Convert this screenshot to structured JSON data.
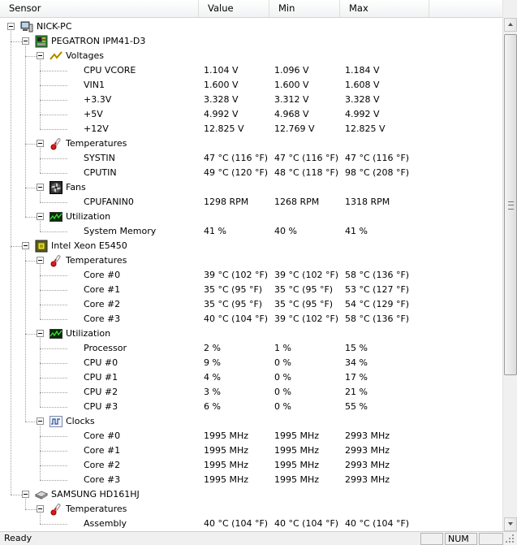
{
  "columns": {
    "sensor": "Sensor",
    "value": "Value",
    "min": "Min",
    "max": "Max"
  },
  "rows": [
    {
      "level": 0,
      "kind": "node",
      "icon": "computer-icon",
      "label": "NICK-PC"
    },
    {
      "level": 1,
      "kind": "node",
      "icon": "motherboard-icon",
      "label": "PEGATRON IPM41-D3"
    },
    {
      "level": 2,
      "kind": "node",
      "icon": "voltage-icon",
      "label": "Voltages"
    },
    {
      "level": 3,
      "kind": "leaf",
      "label": "CPU VCORE",
      "value": "1.104 V",
      "min": "1.096 V",
      "max": "1.184 V"
    },
    {
      "level": 3,
      "kind": "leaf",
      "label": "VIN1",
      "value": "1.600 V",
      "min": "1.600 V",
      "max": "1.608 V"
    },
    {
      "level": 3,
      "kind": "leaf",
      "label": "+3.3V",
      "value": "3.328 V",
      "min": "3.312 V",
      "max": "3.328 V"
    },
    {
      "level": 3,
      "kind": "leaf",
      "label": "+5V",
      "value": "4.992 V",
      "min": "4.968 V",
      "max": "4.992 V"
    },
    {
      "level": 3,
      "kind": "leaf",
      "label": "+12V",
      "value": "12.825 V",
      "min": "12.769 V",
      "max": "12.825 V"
    },
    {
      "level": 2,
      "kind": "node",
      "icon": "thermometer-icon",
      "label": "Temperatures"
    },
    {
      "level": 3,
      "kind": "leaf",
      "label": "SYSTIN",
      "value": "47 °C  (116 °F)",
      "min": "47 °C  (116 °F)",
      "max": "47 °C  (116 °F)"
    },
    {
      "level": 3,
      "kind": "leaf",
      "label": "CPUTIN",
      "value": "49 °C  (120 °F)",
      "min": "48 °C  (118 °F)",
      "max": "98 °C  (208 °F)"
    },
    {
      "level": 2,
      "kind": "node",
      "icon": "fan-icon",
      "label": "Fans"
    },
    {
      "level": 3,
      "kind": "leaf",
      "label": "CPUFANIN0",
      "value": "1298 RPM",
      "min": "1268 RPM",
      "max": "1318 RPM"
    },
    {
      "level": 2,
      "kind": "node",
      "icon": "utilization-icon",
      "label": "Utilization"
    },
    {
      "level": 3,
      "kind": "leaf",
      "label": "System Memory",
      "value": "41 %",
      "min": "40 %",
      "max": "41 %"
    },
    {
      "level": 1,
      "kind": "node",
      "icon": "cpu-chip-icon",
      "label": "Intel Xeon E5450"
    },
    {
      "level": 2,
      "kind": "node",
      "icon": "thermometer-icon",
      "label": "Temperatures"
    },
    {
      "level": 3,
      "kind": "leaf",
      "label": "Core #0",
      "value": "39 °C  (102 °F)",
      "min": "39 °C  (102 °F)",
      "max": "58 °C  (136 °F)"
    },
    {
      "level": 3,
      "kind": "leaf",
      "label": "Core #1",
      "value": "35 °C  (95 °F)",
      "min": "35 °C  (95 °F)",
      "max": "53 °C  (127 °F)"
    },
    {
      "level": 3,
      "kind": "leaf",
      "label": "Core #2",
      "value": "35 °C  (95 °F)",
      "min": "35 °C  (95 °F)",
      "max": "54 °C  (129 °F)"
    },
    {
      "level": 3,
      "kind": "leaf",
      "label": "Core #3",
      "value": "40 °C  (104 °F)",
      "min": "39 °C  (102 °F)",
      "max": "58 °C  (136 °F)"
    },
    {
      "level": 2,
      "kind": "node",
      "icon": "utilization-icon",
      "label": "Utilization"
    },
    {
      "level": 3,
      "kind": "leaf",
      "label": "Processor",
      "value": "2 %",
      "min": "1 %",
      "max": "15 %"
    },
    {
      "level": 3,
      "kind": "leaf",
      "label": "CPU #0",
      "value": "9 %",
      "min": "0 %",
      "max": "34 %"
    },
    {
      "level": 3,
      "kind": "leaf",
      "label": "CPU #1",
      "value": "4 %",
      "min": "0 %",
      "max": "17 %"
    },
    {
      "level": 3,
      "kind": "leaf",
      "label": "CPU #2",
      "value": "3 %",
      "min": "0 %",
      "max": "21 %"
    },
    {
      "level": 3,
      "kind": "leaf",
      "label": "CPU #3",
      "value": "6 %",
      "min": "0 %",
      "max": "55 %"
    },
    {
      "level": 2,
      "kind": "node",
      "icon": "clock-icon",
      "label": "Clocks"
    },
    {
      "level": 3,
      "kind": "leaf",
      "label": "Core #0",
      "value": "1995 MHz",
      "min": "1995 MHz",
      "max": "2993 MHz"
    },
    {
      "level": 3,
      "kind": "leaf",
      "label": "Core #1",
      "value": "1995 MHz",
      "min": "1995 MHz",
      "max": "2993 MHz"
    },
    {
      "level": 3,
      "kind": "leaf",
      "label": "Core #2",
      "value": "1995 MHz",
      "min": "1995 MHz",
      "max": "2993 MHz"
    },
    {
      "level": 3,
      "kind": "leaf",
      "label": "Core #3",
      "value": "1995 MHz",
      "min": "1995 MHz",
      "max": "2993 MHz"
    },
    {
      "level": 1,
      "kind": "node",
      "icon": "hard-drive-icon",
      "label": "SAMSUNG HD161HJ"
    },
    {
      "level": 2,
      "kind": "node",
      "icon": "thermometer-icon",
      "label": "Temperatures"
    },
    {
      "level": 3,
      "kind": "leaf",
      "label": "Assembly",
      "value": "40 °C  (104 °F)",
      "min": "40 °C  (104 °F)",
      "max": "40 °C  (104 °F)"
    }
  ],
  "status": {
    "text": "Ready",
    "num": "NUM"
  }
}
